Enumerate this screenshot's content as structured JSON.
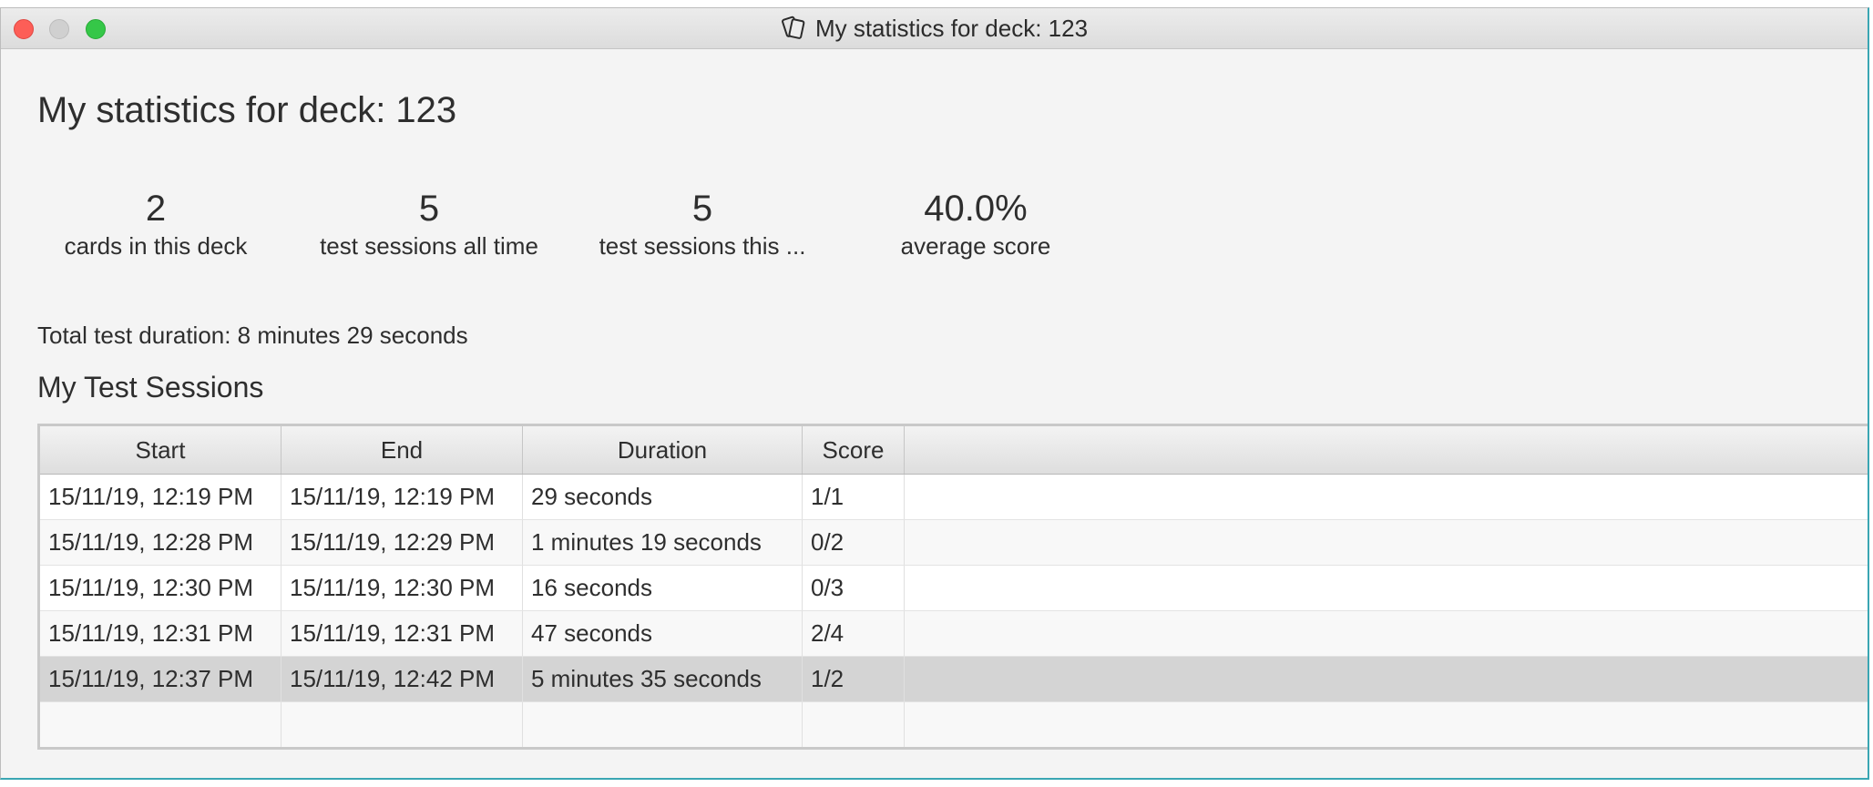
{
  "window": {
    "title": "My statistics for deck: 123",
    "icon": "cards-icon"
  },
  "page": {
    "heading": "My statistics for deck: 123"
  },
  "stats": [
    {
      "value": "2",
      "label": "cards in this deck"
    },
    {
      "value": "5",
      "label": "test sessions all time"
    },
    {
      "value": "5",
      "label": "test sessions this ..."
    },
    {
      "value": "40.0%",
      "label": "average score"
    }
  ],
  "total_duration": "Total test duration: 8 minutes 29 seconds",
  "sessions": {
    "title": "My Test Sessions",
    "columns": [
      "Start",
      "End",
      "Duration",
      "Score"
    ],
    "rows": [
      {
        "start": "15/11/19, 12:19 PM",
        "end": "15/11/19, 12:19 PM",
        "duration": "29 seconds",
        "score": "1/1"
      },
      {
        "start": "15/11/19, 12:28 PM",
        "end": "15/11/19, 12:29 PM",
        "duration": "1 minutes 19 seconds",
        "score": "0/2"
      },
      {
        "start": "15/11/19, 12:30 PM",
        "end": "15/11/19, 12:30 PM",
        "duration": "16 seconds",
        "score": "0/3"
      },
      {
        "start": "15/11/19, 12:31 PM",
        "end": "15/11/19, 12:31 PM",
        "duration": "47 seconds",
        "score": "2/4"
      },
      {
        "start": "15/11/19, 12:37 PM",
        "end": "15/11/19, 12:42 PM",
        "duration": "5 minutes 35 seconds",
        "score": "1/2"
      }
    ],
    "selected_row": 4
  }
}
